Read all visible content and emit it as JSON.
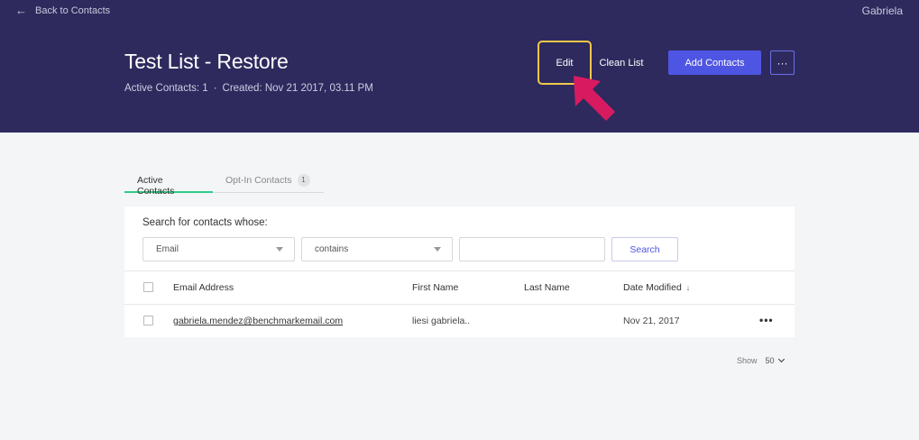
{
  "header": {
    "back_label": "Back to Contacts",
    "user_name": "Gabriela",
    "title": "Test List - Restore",
    "meta_active": "Active Contacts: 1",
    "meta_separator": "·",
    "meta_created": "Created: Nov 21 2017, 03.11 PM",
    "edit_label": "Edit",
    "clean_label": "Clean List",
    "add_label": "Add Contacts",
    "more_label": "···",
    "colors": {
      "background": "#2e2a5e",
      "accent": "#4f55e3",
      "highlight": "#f2c84b",
      "pointer": "#d81b60"
    }
  },
  "tabs": {
    "active_label": "Active Contacts",
    "optin_label": "Opt-In Contacts",
    "optin_count": "1"
  },
  "search": {
    "label": "Search for contacts whose:",
    "field_value": "Email",
    "operator_value": "contains",
    "input_value": "",
    "button_label": "Search"
  },
  "table": {
    "columns": {
      "email": "Email Address",
      "first": "First Name",
      "last": "Last Name",
      "date": "Date Modified",
      "sort_indicator": "↓"
    },
    "rows": [
      {
        "email": "gabriela.mendez@benchmarkemail.com",
        "first": "liesi gabriela..",
        "last": "",
        "date": "Nov 21, 2017",
        "menu": "•••"
      }
    ]
  },
  "pager": {
    "show_label": "Show",
    "page_size": "50"
  }
}
